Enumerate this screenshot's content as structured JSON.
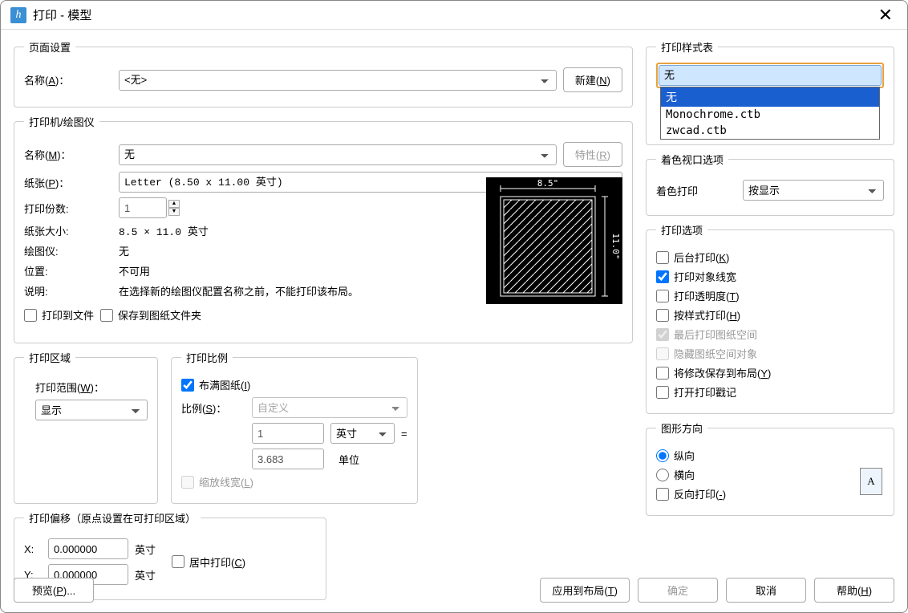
{
  "window": {
    "title": "打印 - 模型"
  },
  "page_setup": {
    "legend": "页面设置",
    "name_label": "名称(A)：",
    "name_value": "<无>",
    "new_btn": "新建(N)"
  },
  "printer": {
    "legend": "打印机/绘图仪",
    "name_label": "名称(M)：",
    "name_value": "无",
    "props_btn": "特性(R)",
    "paper_label": "纸张(P)：",
    "paper_value": "Letter (8.50 x 11.00 英寸)",
    "copies_label": "打印份数:",
    "copies_value": "1",
    "size_label": "纸张大小:",
    "size_value": "8.5 × 11.0  英寸",
    "plotter_label": "绘图仪:",
    "plotter_value": "无",
    "location_label": "位置:",
    "location_value": "不可用",
    "desc_label": "说明:",
    "desc_value": "在选择新的绘图仪配置名称之前，不能打印该布局。",
    "print_to_file": "打印到文件",
    "save_to_folder": "保存到图纸文件夹",
    "preview_w": "8.5\"",
    "preview_h": "11.0\""
  },
  "area": {
    "legend": "打印区域",
    "range_label": "打印范围(W)：",
    "range_value": "显示"
  },
  "scale": {
    "legend": "打印比例",
    "fit": "布满图纸(I)",
    "ratio_label": "比例(S)：",
    "ratio_value": "自定义",
    "unit_top_value": "1",
    "unit_top_label": "英寸",
    "eq": "=",
    "unit_bot_value": "3.683",
    "unit_bot_label": "单位",
    "scale_lw": "缩放线宽(L)"
  },
  "offset": {
    "legend": "打印偏移（原点设置在可打印区域）",
    "x_label": "X:",
    "x_value": "0.000000",
    "x_unit": "英寸",
    "y_label": "Y:",
    "y_value": "0.000000",
    "y_unit": "英寸",
    "center": "居中打印(C)"
  },
  "style": {
    "legend": "打印样式表",
    "selected": "无",
    "options": [
      "无",
      "Monochrome.ctb",
      "zwcad.ctb"
    ]
  },
  "shaded": {
    "legend": "着色视口选项",
    "label": "着色打印",
    "value": "按显示"
  },
  "options": {
    "legend": "打印选项",
    "bg": "后台打印(K)",
    "lw": "打印对象线宽",
    "trans": "打印透明度(T)",
    "by_style": "按样式打印(H)",
    "paperspace_last": "最后打印图纸空间",
    "hide_ps": "隐藏图纸空间对象",
    "save_layout": "将修改保存到布局(Y)",
    "stamp": "打开打印戳记"
  },
  "orient": {
    "legend": "图形方向",
    "portrait": "纵向",
    "landscape": "横向",
    "upside": "反向打印(-)"
  },
  "footer": {
    "preview": "预览(P)...",
    "apply": "应用到布局(T)",
    "ok": "确定",
    "cancel": "取消",
    "help": "帮助(H)"
  }
}
